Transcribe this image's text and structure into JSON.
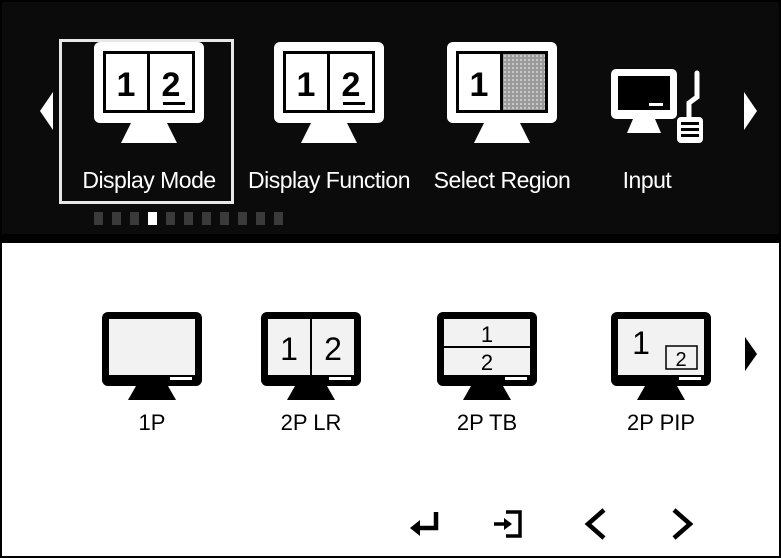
{
  "menu": {
    "items": [
      {
        "label": "Display Mode",
        "icon": "split-monitor-icon",
        "selected": true
      },
      {
        "label": "Display Function",
        "icon": "split-monitor-icon",
        "selected": false
      },
      {
        "label": "Select Region",
        "icon": "region-monitor-icon",
        "selected": false
      },
      {
        "label": "Input",
        "icon": "monitor-keyboard-icon",
        "selected": false
      }
    ],
    "page_count": 11,
    "current_page": 4
  },
  "options": {
    "items": [
      {
        "label": "1P",
        "icon": "single-monitor-icon"
      },
      {
        "label": "2P LR",
        "icon": "monitor-left-right-icon",
        "left": "1",
        "right": "2"
      },
      {
        "label": "2P TB",
        "icon": "monitor-top-bottom-icon",
        "top": "1",
        "bottom": "2"
      },
      {
        "label": "2P PIP",
        "icon": "monitor-pip-icon",
        "main": "1",
        "pip": "2"
      }
    ]
  },
  "icons": {
    "split_left": "1",
    "split_right": "2",
    "region": "1"
  },
  "nav": {
    "icons": [
      "enter-icon",
      "exit-icon",
      "previous-icon",
      "next-icon"
    ]
  },
  "colors": {
    "menu_bg": "#0b0b0b",
    "selected_border": "#e8e8e8",
    "content_bg": "#ffffff"
  }
}
